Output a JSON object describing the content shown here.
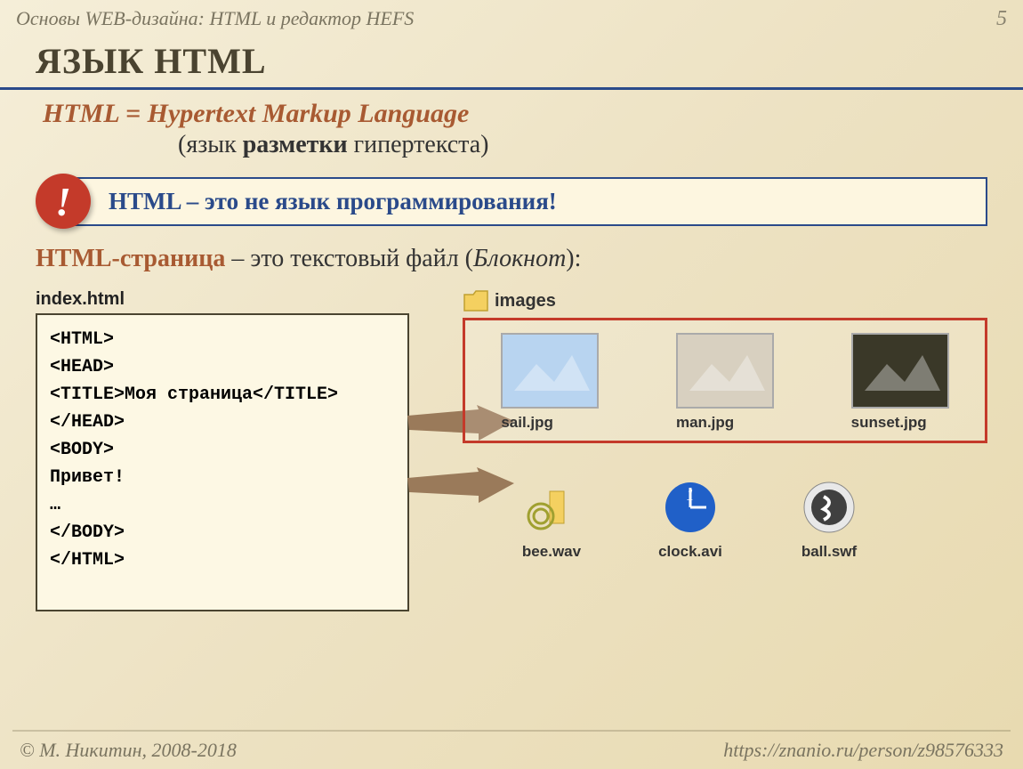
{
  "header": {
    "breadcrumb": "Основы WEB-дизайна: HTML и редактор HEFS",
    "page_number": "5"
  },
  "title": "ЯЗЫК HTML",
  "definition": {
    "line1": "HTML = Hypertext Markup Language",
    "line2_prefix": "(язык ",
    "line2_bold": "разметки",
    "line2_suffix": " гипертекста)"
  },
  "callout": {
    "bang": "!",
    "text": "HTML – это не язык программирования!"
  },
  "page_desc": {
    "orange": "HTML-страница",
    "mid": " – это текстовый файл (",
    "italic": "Блокнот",
    "end": "):"
  },
  "code": {
    "filename": "index.html",
    "lines": [
      "<HTML>",
      "<HEAD>",
      "<TITLE>Моя страница</TITLE>",
      "</HEAD>",
      "<BODY>",
      "Привет!",
      "…",
      "</BODY>",
      "</HTML>"
    ]
  },
  "images_folder": {
    "label": "images",
    "items": [
      {
        "name": "sail.jpg",
        "bg": "#b8d4f0"
      },
      {
        "name": "man.jpg",
        "bg": "#d8d0c0"
      },
      {
        "name": "sunset.jpg",
        "bg": "#3a3828"
      }
    ]
  },
  "files": [
    {
      "name": "bee.wav",
      "type": "audio"
    },
    {
      "name": "clock.avi",
      "type": "video"
    },
    {
      "name": "ball.swf",
      "type": "flash"
    }
  ],
  "footer": {
    "copyright": "© М. Никитин, 2008-2018",
    "url": "https://znanio.ru/person/z98576333"
  }
}
